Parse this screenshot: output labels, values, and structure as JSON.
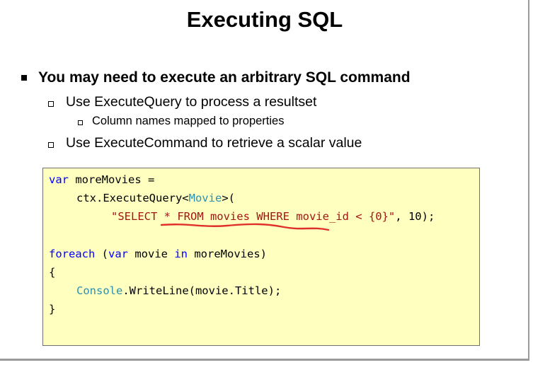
{
  "slide": {
    "title": "Executing SQL",
    "bullets": {
      "main": "You may need to execute an arbitrary SQL command",
      "sub1": "Use ExecuteQuery to process a resultset",
      "sub1_child": "Column names mapped to properties",
      "sub2": "Use ExecuteCommand to retrieve a scalar value"
    },
    "code": {
      "line1_kw": "var",
      "line1_rest": " moreMovies =",
      "line2_a": "ctx.ExecuteQuery<",
      "line2_type": "Movie",
      "line2_b": ">(",
      "line3_str": "\"SELECT * FROM movies WHERE movie_id < {0}\"",
      "line3_rest": ", 10);",
      "line4_kw1": "foreach",
      "line4_a": " (",
      "line4_kw2": "var",
      "line4_b": " movie ",
      "line4_kw3": "in",
      "line4_c": " moreMovies)",
      "line5": "{",
      "line6_type": "Console",
      "line6_rest": ".WriteLine(movie.Title);",
      "line7": "}"
    },
    "colors": {
      "keyword": "#0000ff",
      "type": "#2b91af",
      "string": "#a31515",
      "code_background": "#ffffc0",
      "annotation_underline": "#e0302a"
    }
  }
}
